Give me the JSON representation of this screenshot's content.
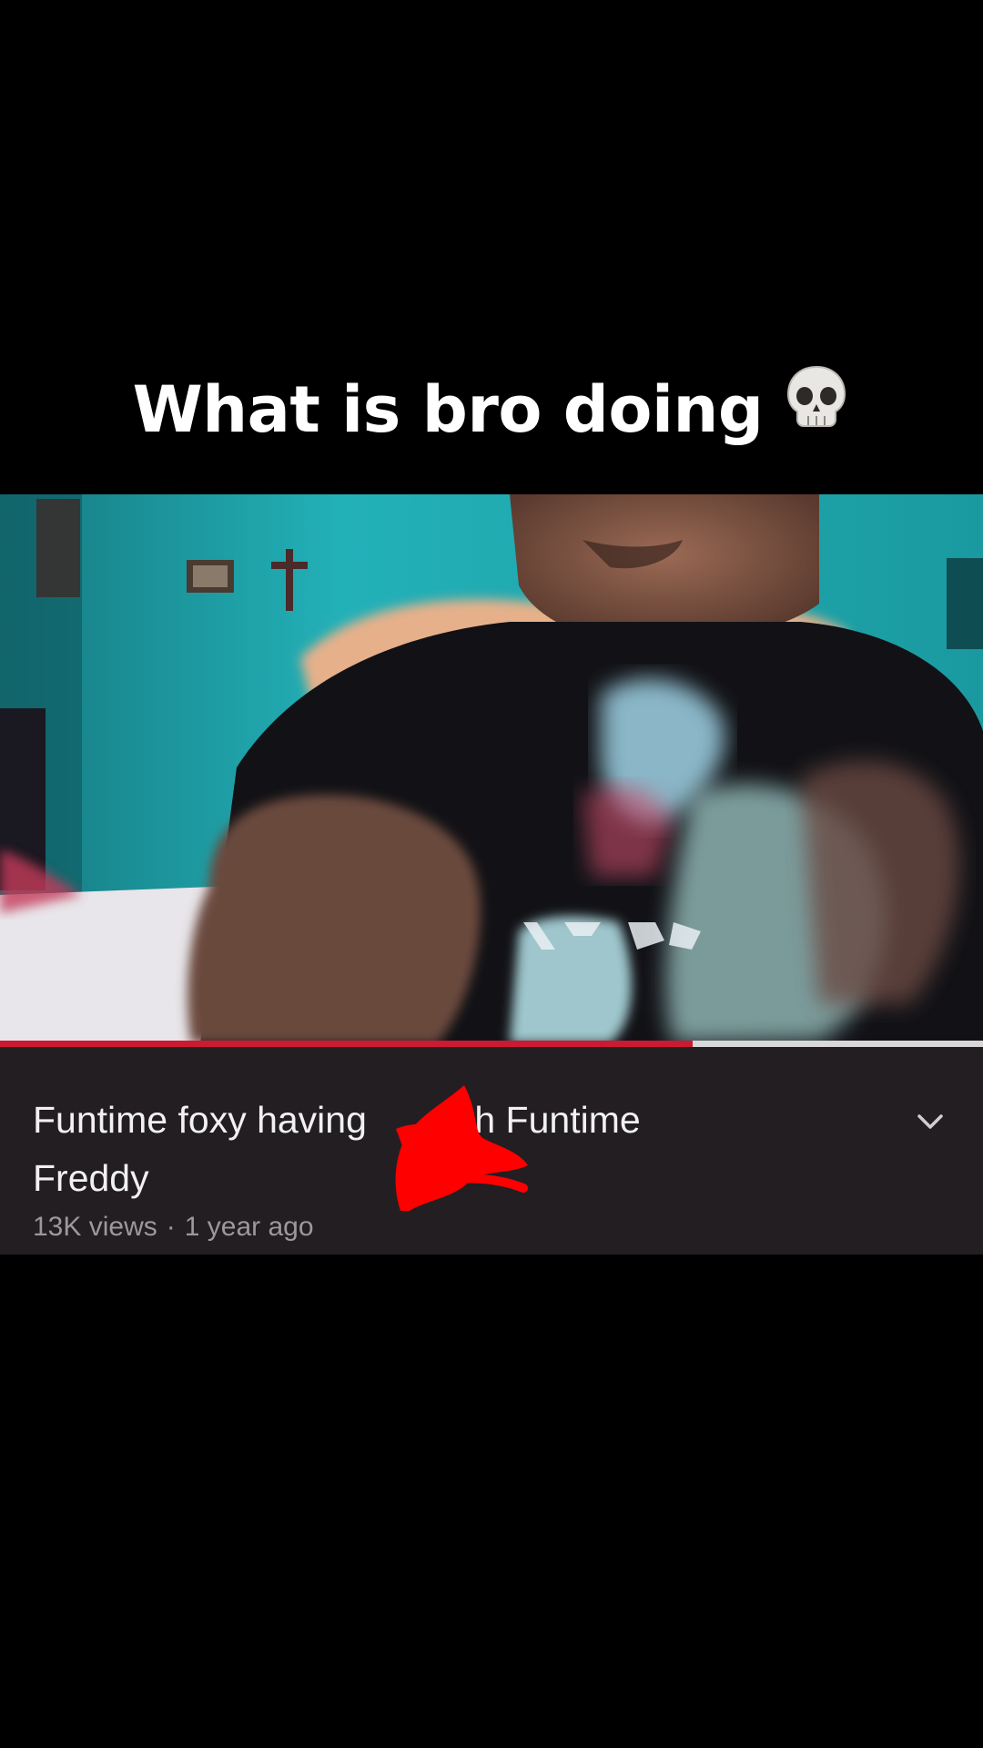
{
  "caption": {
    "text": "What is bro doing",
    "emoji": "💀"
  },
  "video": {
    "title": "Funtime foxy having ___ with Funtime Freddy",
    "title_line1": "Funtime foxy having      with Funtime",
    "title_line2": "Freddy",
    "views": "13K views",
    "separator": "·",
    "age": "1 year ago",
    "progress": 0.705
  },
  "icons": {
    "expand": "chevron-down-icon",
    "emoji": "skull-emoji-icon"
  },
  "colors": {
    "background": "#000000",
    "panel": "#221e22",
    "progress": "#cc1a33",
    "scribble": "#ff0000",
    "wall": "#1ea7ad"
  }
}
